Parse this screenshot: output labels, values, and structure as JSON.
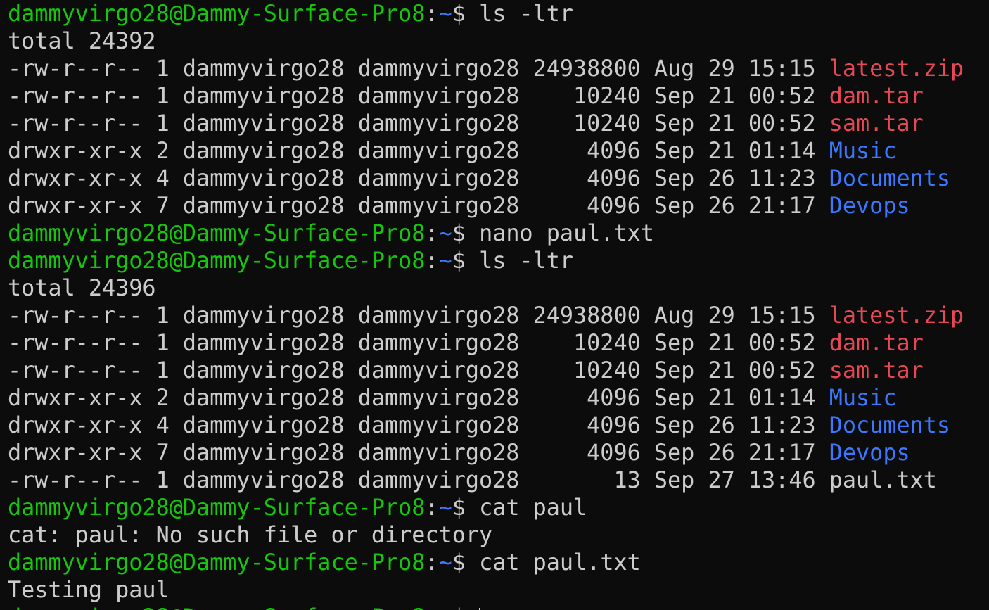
{
  "theme": {
    "background": "#0c0c0c",
    "foreground": "#cccccc",
    "prompt_user_color": "#16c60c",
    "prompt_path_color": "#3b78ff",
    "archive_color": "#e74856",
    "directory_color": "#3b78ff"
  },
  "prompt": {
    "user_host": "dammyvirgo28@Dammy-Surface-Pro8",
    "colon": ":",
    "path": "~",
    "symbol": "$ "
  },
  "lines": [
    {
      "type": "prompt",
      "command": "ls -ltr"
    },
    {
      "type": "text",
      "text": "total 24392"
    },
    {
      "type": "ls",
      "meta": "-rw-r--r-- 1 dammyvirgo28 dammyvirgo28 24938800 Aug 29 15:15 ",
      "name": "latest.zip",
      "kind": "archive"
    },
    {
      "type": "ls",
      "meta": "-rw-r--r-- 1 dammyvirgo28 dammyvirgo28    10240 Sep 21 00:52 ",
      "name": "dam.tar",
      "kind": "archive"
    },
    {
      "type": "ls",
      "meta": "-rw-r--r-- 1 dammyvirgo28 dammyvirgo28    10240 Sep 21 00:52 ",
      "name": "sam.tar",
      "kind": "archive"
    },
    {
      "type": "ls",
      "meta": "drwxr-xr-x 2 dammyvirgo28 dammyvirgo28     4096 Sep 21 01:14 ",
      "name": "Music",
      "kind": "dir"
    },
    {
      "type": "ls",
      "meta": "drwxr-xr-x 4 dammyvirgo28 dammyvirgo28     4096 Sep 26 11:23 ",
      "name": "Documents",
      "kind": "dir"
    },
    {
      "type": "ls",
      "meta": "drwxr-xr-x 7 dammyvirgo28 dammyvirgo28     4096 Sep 26 21:17 ",
      "name": "Devops",
      "kind": "dir"
    },
    {
      "type": "prompt",
      "command": "nano paul.txt"
    },
    {
      "type": "prompt",
      "command": "ls -ltr"
    },
    {
      "type": "text",
      "text": "total 24396"
    },
    {
      "type": "ls",
      "meta": "-rw-r--r-- 1 dammyvirgo28 dammyvirgo28 24938800 Aug 29 15:15 ",
      "name": "latest.zip",
      "kind": "archive"
    },
    {
      "type": "ls",
      "meta": "-rw-r--r-- 1 dammyvirgo28 dammyvirgo28    10240 Sep 21 00:52 ",
      "name": "dam.tar",
      "kind": "archive"
    },
    {
      "type": "ls",
      "meta": "-rw-r--r-- 1 dammyvirgo28 dammyvirgo28    10240 Sep 21 00:52 ",
      "name": "sam.tar",
      "kind": "archive"
    },
    {
      "type": "ls",
      "meta": "drwxr-xr-x 2 dammyvirgo28 dammyvirgo28     4096 Sep 21 01:14 ",
      "name": "Music",
      "kind": "dir"
    },
    {
      "type": "ls",
      "meta": "drwxr-xr-x 4 dammyvirgo28 dammyvirgo28     4096 Sep 26 11:23 ",
      "name": "Documents",
      "kind": "dir"
    },
    {
      "type": "ls",
      "meta": "drwxr-xr-x 7 dammyvirgo28 dammyvirgo28     4096 Sep 26 21:17 ",
      "name": "Devops",
      "kind": "dir"
    },
    {
      "type": "ls",
      "meta": "-rw-r--r-- 1 dammyvirgo28 dammyvirgo28       13 Sep 27 13:46 ",
      "name": "paul.txt",
      "kind": "file"
    },
    {
      "type": "prompt",
      "command": "cat paul"
    },
    {
      "type": "text",
      "text": "cat: paul: No such file or directory"
    },
    {
      "type": "prompt",
      "command": "cat paul.txt"
    },
    {
      "type": "text",
      "text": "Testing paul"
    },
    {
      "type": "prompt",
      "command": "",
      "active": true
    }
  ]
}
